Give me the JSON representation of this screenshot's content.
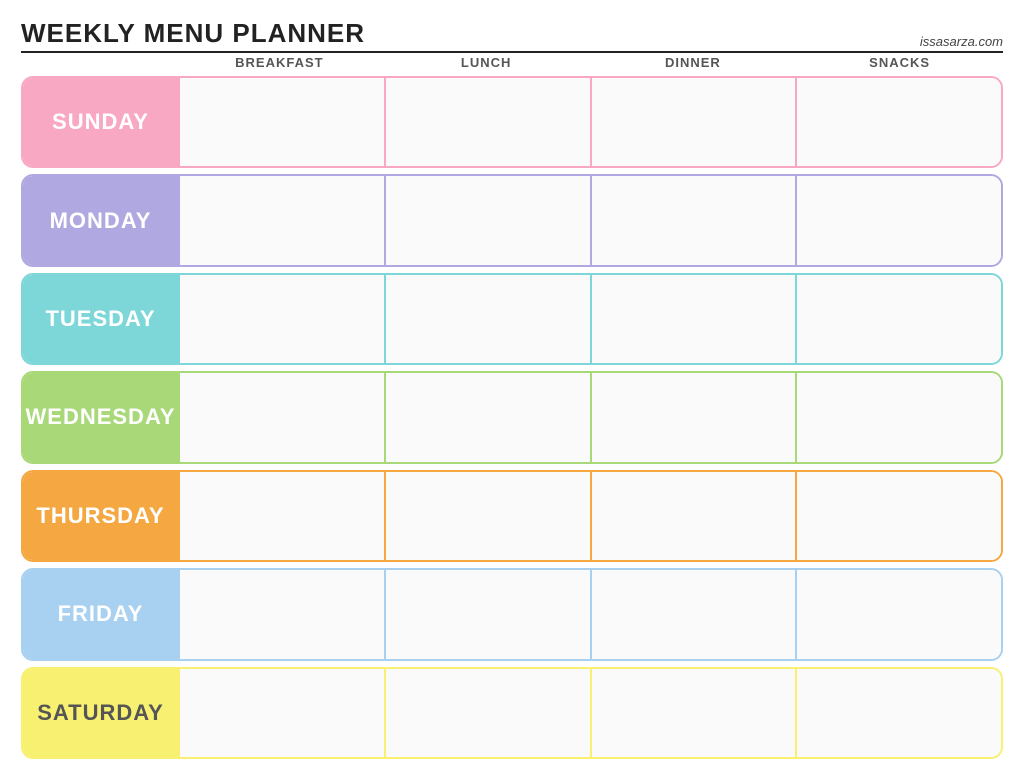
{
  "header": {
    "title": "Weekly Menu Planner",
    "website": "issasarza.com"
  },
  "columns": {
    "spacer": "",
    "breakfast": "Breakfast",
    "lunch": "Lunch",
    "dinner": "Dinner",
    "snacks": "Snacks"
  },
  "days": [
    {
      "id": "sunday",
      "label": "Sunday",
      "class": "row-sunday"
    },
    {
      "id": "monday",
      "label": "Monday",
      "class": "row-monday"
    },
    {
      "id": "tuesday",
      "label": "Tuesday",
      "class": "row-tuesday"
    },
    {
      "id": "wednesday",
      "label": "Wednesday",
      "class": "row-wednesday"
    },
    {
      "id": "thursday",
      "label": "Thursday",
      "class": "row-thursday"
    },
    {
      "id": "friday",
      "label": "Friday",
      "class": "row-friday"
    },
    {
      "id": "saturday",
      "label": "Saturday",
      "class": "row-saturday"
    }
  ]
}
